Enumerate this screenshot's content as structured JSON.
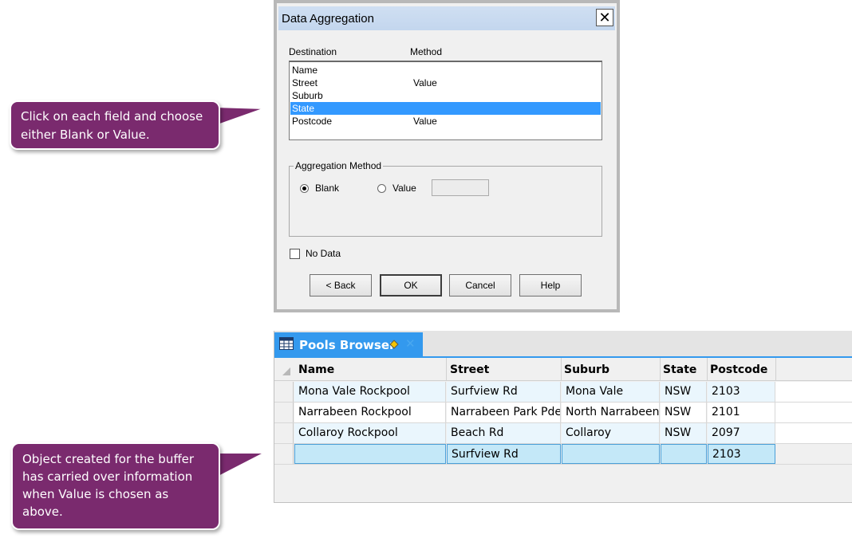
{
  "callouts": {
    "top_text": "Click on each  field and choose either Blank or Value.",
    "bottom_text": "Object created for the buffer has carried over information when Value is chosen as above."
  },
  "dialog": {
    "title": "Data Aggregation",
    "close_glyph": "✕",
    "col_destination": "Destination",
    "col_method": "Method",
    "rows": [
      {
        "destination": "Name",
        "method": ""
      },
      {
        "destination": "Street",
        "method": "Value"
      },
      {
        "destination": "Suburb",
        "method": ""
      },
      {
        "destination": "State",
        "method": ""
      },
      {
        "destination": "Postcode",
        "method": "Value"
      }
    ],
    "selected_row": "State",
    "aggregation_group_label": "Aggregation Method",
    "radio_blank": "Blank",
    "radio_value": "Value",
    "radio_selected": "Blank",
    "value_input": "",
    "no_data_label": "No Data",
    "no_data_checked": false,
    "buttons": {
      "back": "< Back",
      "ok": "OK",
      "cancel": "Cancel",
      "help": "Help"
    }
  },
  "browser": {
    "tab_title": "Pools Browser",
    "tab_close_glyph": "✕",
    "accent_color": "#3399ee",
    "columns": [
      "Name",
      "Street",
      "Suburb",
      "State",
      "Postcode"
    ],
    "rows": [
      {
        "name": "Mona Vale Rockpool",
        "street": "Surfview Rd",
        "suburb": "Mona Vale",
        "state": "NSW",
        "postcode": "2103"
      },
      {
        "name": "Narrabeen Rockpool",
        "street": "Narrabeen Park Pde",
        "suburb": "North Narrabeen",
        "state": "NSW",
        "postcode": "2101"
      },
      {
        "name": "Collaroy Rockpool",
        "street": "Beach Rd",
        "suburb": "Collaroy",
        "state": "NSW",
        "postcode": "2097"
      },
      {
        "name": "",
        "street": "Surfview Rd",
        "suburb": "",
        "state": "",
        "postcode": "2103"
      }
    ]
  }
}
